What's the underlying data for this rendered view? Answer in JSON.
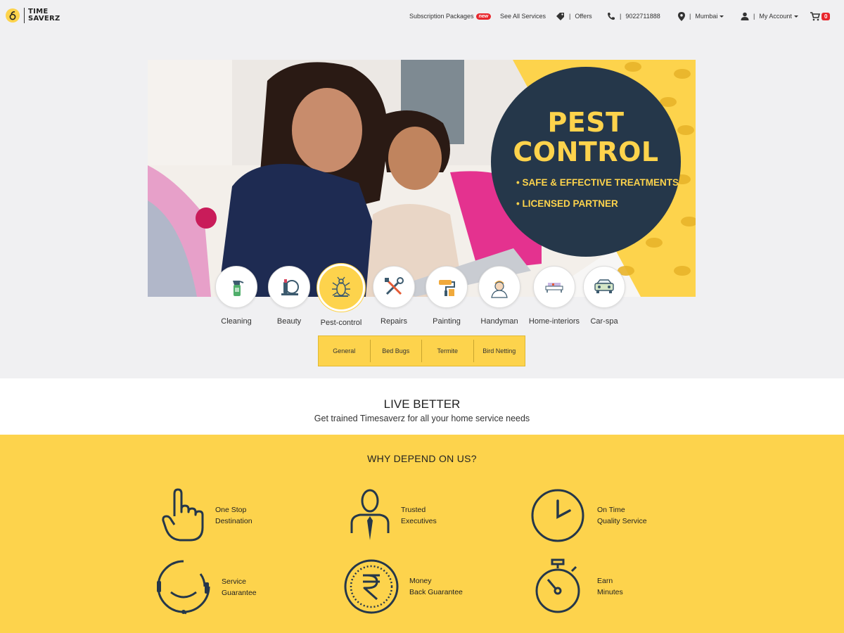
{
  "header": {
    "logo_line1": "TIME",
    "logo_line2": "SAVERZ",
    "nav": {
      "subscription": "Subscription Packages",
      "new_badge": "new",
      "services": "See All Services",
      "offers": "Offers",
      "phone": "9022711888",
      "city": "Mumbai",
      "account": "My Account",
      "cart_count": "0"
    }
  },
  "banner": {
    "title_line1": "PEST",
    "title_line2": "CONTROL",
    "bullet1": "• SAFE & EFFECTIVE TREATMENTS",
    "bullet2": "• LICENSED PARTNER"
  },
  "categories": [
    {
      "label": "Cleaning",
      "icon": "spray-bottle-icon"
    },
    {
      "label": "Beauty",
      "icon": "makeup-icon"
    },
    {
      "label": "Pest-control",
      "icon": "bug-icon",
      "active": true
    },
    {
      "label": "Repairs",
      "icon": "tools-icon"
    },
    {
      "label": "Painting",
      "icon": "paint-roller-icon"
    },
    {
      "label": "Handyman",
      "icon": "handyman-icon"
    },
    {
      "label": "Home-interiors",
      "icon": "sofa-icon"
    },
    {
      "label": "Car-spa",
      "icon": "car-icon"
    }
  ],
  "subtabs": [
    "General",
    "Bed Bugs",
    "Termite",
    "Bird Netting"
  ],
  "live_better": {
    "title": "LIVE BETTER",
    "subtitle": "Get trained Timesaverz for all your home service needs"
  },
  "why": {
    "title": "WHY DEPEND ON US?",
    "features": [
      {
        "line1": "One Stop",
        "line2": "Destination",
        "icon": "pointing-hand-icon"
      },
      {
        "line1": "Trusted",
        "line2": "Executives",
        "icon": "executive-icon"
      },
      {
        "line1": "On Time",
        "line2": "Quality Service",
        "icon": "clock-icon"
      },
      {
        "line1": "Service",
        "line2": "Guarantee",
        "icon": "headset-icon"
      },
      {
        "line1": "Money",
        "line2": "Back Guarantee",
        "icon": "rupee-coin-icon"
      },
      {
        "line1": "Earn",
        "line2": "Minutes",
        "icon": "stopwatch-icon"
      }
    ]
  },
  "colors": {
    "brand_yellow": "#fdd34c",
    "navy": "#25374a",
    "badge_red": "#e8262c"
  }
}
